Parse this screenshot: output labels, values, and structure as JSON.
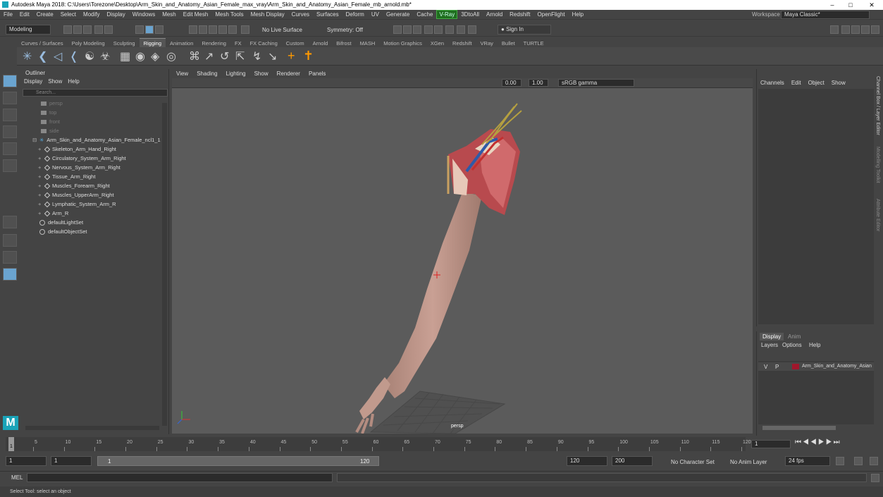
{
  "window": {
    "title": "Autodesk Maya 2018: C:\\Users\\Torezone\\Desktop\\Arm_Skin_and_Anatomy_Asian_Female_max_vray\\Arm_Skin_and_Anatomy_Asian_Female_mb_arnold.mb*"
  },
  "menubar": [
    "File",
    "Edit",
    "Create",
    "Select",
    "Modify",
    "Display",
    "Windows",
    "Mesh",
    "Edit Mesh",
    "Mesh Tools",
    "Mesh Display",
    "Curves",
    "Surfaces",
    "Deform",
    "UV",
    "Generate",
    "Cache",
    "V-Ray",
    "3DtoAll",
    "Arnold",
    "Redshift",
    "OpenFlight",
    "Help"
  ],
  "workspace": {
    "label": "Workspace :",
    "value": "Maya Classic*"
  },
  "status": {
    "mode": "Modeling",
    "live_surface": "No Live Surface",
    "symmetry": "Symmetry: Off",
    "sign_in": "Sign In"
  },
  "shelf_tabs": [
    "Curves / Surfaces",
    "Poly Modeling",
    "Sculpting",
    "Rigging",
    "Animation",
    "Rendering",
    "FX",
    "FX Caching",
    "Custom",
    "Arnold",
    "Bifrost",
    "MASH",
    "Motion Graphics",
    "XGen",
    "Redshift",
    "VRay",
    "Bullet",
    "TURTLE"
  ],
  "shelf_active": "Rigging",
  "outliner": {
    "title": "Outliner",
    "menu": [
      "Display",
      "Show",
      "Help"
    ],
    "search_placeholder": "Search...",
    "cameras": [
      "persp",
      "top",
      "front",
      "side"
    ],
    "root": "Arm_Skin_and_Anatomy_Asian_Female_ncl1_1",
    "children": [
      "Skeleton_Arm_Hand_Right",
      "Circulatory_System_Arm_Right",
      "Nervous_System_Arm_Right",
      "Tissue_Arm_Right",
      "Muscles_Forearm_Right",
      "Muscles_UpperArm_Right",
      "Lymphatic_System_Arm_R",
      "Arm_R"
    ],
    "sets": [
      "defaultLightSet",
      "defaultObjectSet"
    ]
  },
  "viewport": {
    "menu": [
      "View",
      "Shading",
      "Lighting",
      "Show",
      "Renderer",
      "Panels"
    ],
    "field1": "0.00",
    "field2": "1.00",
    "color_space": "sRGB gamma",
    "camera": "persp"
  },
  "channel_box": {
    "menu": [
      "Channels",
      "Edit",
      "Object",
      "Show"
    ]
  },
  "side_tabs": [
    "Channel Box / Layer Editor",
    "Modelling Toolkit",
    "Attribute Editor"
  ],
  "layer_editor": {
    "tabs": [
      "Display",
      "Anim"
    ],
    "menu": [
      "Layers",
      "Options",
      "Help"
    ],
    "layer": {
      "v": "V",
      "p": "P",
      "name": "Arm_Skin_and_Anatomy_Asian",
      "color": "#a0172c"
    }
  },
  "timeline": {
    "ticks": [
      "1",
      "5",
      "10",
      "15",
      "20",
      "25",
      "30",
      "35",
      "40",
      "45",
      "50",
      "55",
      "60",
      "65",
      "70",
      "75",
      "80",
      "85",
      "90",
      "95",
      "100",
      "105",
      "110",
      "115",
      "120"
    ],
    "current": "1"
  },
  "range": {
    "start": "1",
    "start2": "1",
    "slider_start": "1",
    "slider_end": "120",
    "end": "120",
    "end2": "200",
    "char_set": "No Character Set",
    "anim_layer": "No Anim Layer",
    "fps": "24 fps"
  },
  "cmd": {
    "label": "MEL"
  },
  "help": "Select Tool: select an object"
}
